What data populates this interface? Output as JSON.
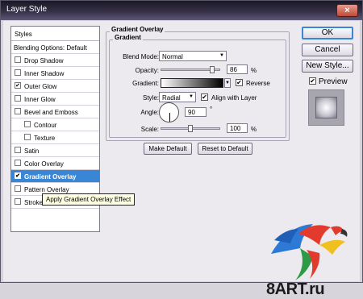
{
  "window": {
    "title": "Layer Style",
    "close_glyph": "×"
  },
  "styles_panel": {
    "header": "Styles",
    "blending_options": "Blending Options: Default",
    "items": [
      {
        "label": "Drop Shadow",
        "checked": false,
        "sub": false,
        "selected": false
      },
      {
        "label": "Inner Shadow",
        "checked": false,
        "sub": false,
        "selected": false
      },
      {
        "label": "Outer Glow",
        "checked": true,
        "sub": false,
        "selected": false
      },
      {
        "label": "Inner Glow",
        "checked": false,
        "sub": false,
        "selected": false
      },
      {
        "label": "Bevel and Emboss",
        "checked": false,
        "sub": false,
        "selected": false
      },
      {
        "label": "Contour",
        "checked": false,
        "sub": true,
        "selected": false
      },
      {
        "label": "Texture",
        "checked": false,
        "sub": true,
        "selected": false
      },
      {
        "label": "Satin",
        "checked": false,
        "sub": false,
        "selected": false
      },
      {
        "label": "Color Overlay",
        "checked": false,
        "sub": false,
        "selected": false
      },
      {
        "label": "Gradient Overlay",
        "checked": true,
        "sub": false,
        "selected": true
      },
      {
        "label": "Pattern Overlay",
        "checked": false,
        "sub": false,
        "selected": false
      },
      {
        "label": "Stroke",
        "checked": false,
        "sub": false,
        "selected": false
      }
    ]
  },
  "tooltip": "Apply Gradient Overlay Effect",
  "gradient_overlay": {
    "group_title": "Gradient Overlay",
    "inner_title": "Gradient",
    "blend_mode_label": "Blend Mode:",
    "blend_mode_value": "Normal",
    "opacity_label": "Opacity:",
    "opacity_value": "86",
    "opacity_fraction": 0.86,
    "percent": "%",
    "gradient_label": "Gradient:",
    "reverse_label": "Reverse",
    "reverse_checked": true,
    "style_label": "Style:",
    "style_value": "Radial",
    "align_label": "Align with Layer",
    "align_checked": true,
    "angle_label": "Angle:",
    "angle_value": "90",
    "degree": "°",
    "scale_label": "Scale:",
    "scale_value": "100",
    "scale_fraction": 0.5,
    "make_default": "Make Default",
    "reset_default": "Reset to Default"
  },
  "actions": {
    "ok": "OK",
    "cancel": "Cancel",
    "new_style": "New Style...",
    "preview_label": "Preview",
    "preview_checked": true
  },
  "watermark": "8ART.ru",
  "colors": {
    "selection": "#3a86d6",
    "title_bar": "#353045"
  },
  "icons": {
    "close": "close-icon",
    "dropdown": "chevron-down-icon",
    "check": "checkmark-icon"
  }
}
